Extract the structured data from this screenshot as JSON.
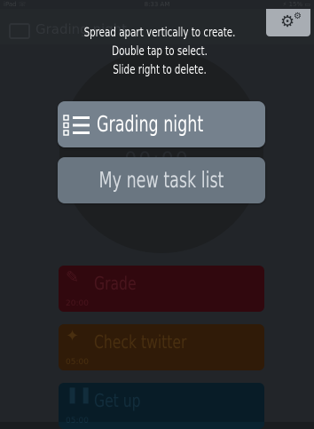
{
  "status_bar": {
    "carrier": "iPad ☏",
    "time": "8:33 AM",
    "battery": "⚡ 15% ▭"
  },
  "background": {
    "header_title": "Grading night",
    "clock": "00:00",
    "tasks": [
      {
        "label": "Grade",
        "time": "20:00",
        "icon": "edit-icon"
      },
      {
        "label": "Check twitter",
        "time": "05:00",
        "icon": "twitter-icon"
      },
      {
        "label": "Get up",
        "time": "05:00",
        "icon": "footprints-icon"
      }
    ]
  },
  "overlay": {
    "instructions": [
      "Spread apart vertically to create.",
      "Double tap to select.",
      "Slide right to delete."
    ],
    "lists": [
      {
        "label": "Grading night",
        "icon": "list-icon"
      },
      {
        "label": "My new task list"
      }
    ]
  },
  "colors": {
    "pill": "#75818d",
    "gear_button": "#a8adb3",
    "grade_task": "#3c0a12",
    "twitter_task": "#3b220a",
    "getup_task": "#0a2330"
  }
}
